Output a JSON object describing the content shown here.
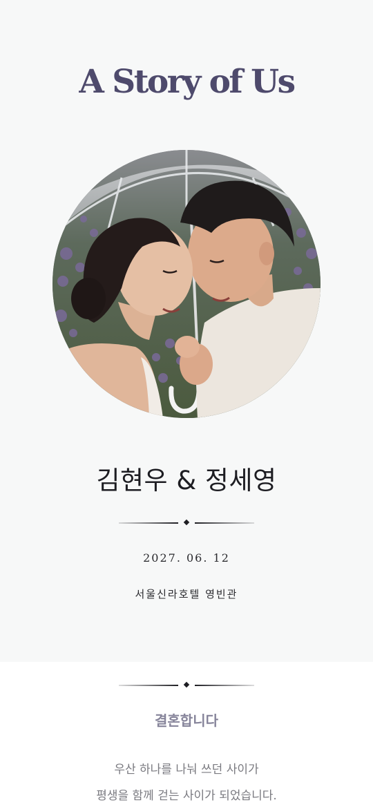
{
  "header": {
    "title": "A Story of Us"
  },
  "hero": {
    "photo_description_icon": "couple-photo",
    "names": "김현우 & 정세영",
    "date": "2027. 06. 12",
    "venue": "서울신라호텔 영빈관"
  },
  "invitation": {
    "heading": "결혼합니다",
    "lines": [
      "우산 하나를 나눠 쓰던 사이가",
      "평생을 함께 걷는 사이가 되었습니다."
    ]
  },
  "colors": {
    "title": "#4e4a6c",
    "hero_background": "#f7f8f8",
    "heading_accent": "#86849a",
    "body_text": "#7a7a80"
  }
}
